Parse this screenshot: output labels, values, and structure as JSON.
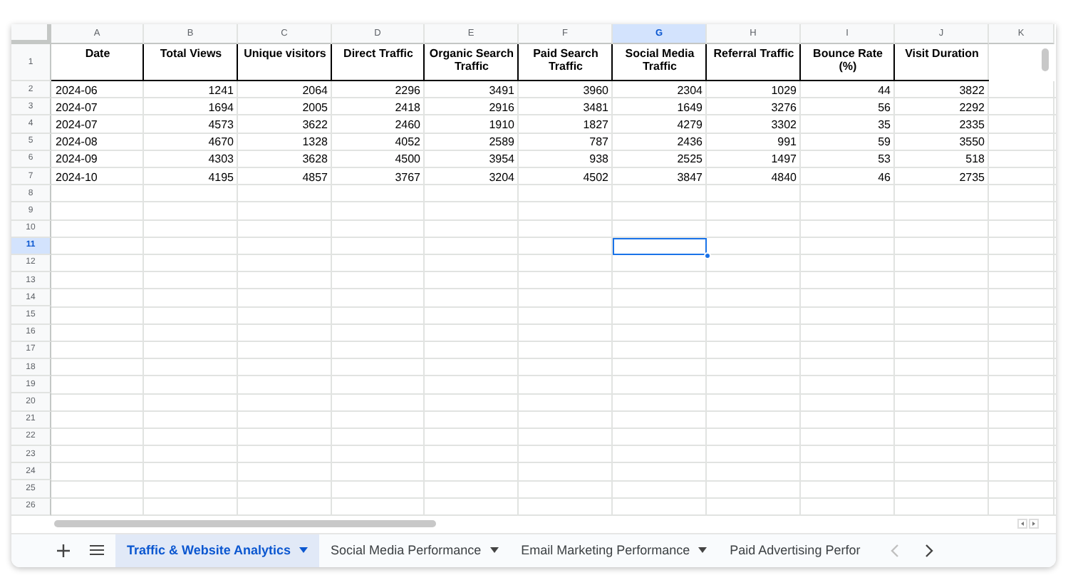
{
  "columns": [
    {
      "label": "A",
      "selected": false,
      "kind": "text"
    },
    {
      "label": "B",
      "selected": false,
      "kind": "number"
    },
    {
      "label": "C",
      "selected": false,
      "kind": "number"
    },
    {
      "label": "D",
      "selected": false,
      "kind": "number"
    },
    {
      "label": "E",
      "selected": false,
      "kind": "number"
    },
    {
      "label": "F",
      "selected": false,
      "kind": "number"
    },
    {
      "label": "G",
      "selected": true,
      "kind": "number"
    },
    {
      "label": "H",
      "selected": false,
      "kind": "number"
    },
    {
      "label": "I",
      "selected": false,
      "kind": "number"
    },
    {
      "label": "J",
      "selected": false,
      "kind": "number"
    },
    {
      "label": "K",
      "selected": false,
      "kind": "number"
    }
  ],
  "rows": [
    {
      "label": "1",
      "selected": false,
      "kind": "header",
      "cells": [
        "Date",
        "Total Views",
        "Unique visitors",
        "Direct Traffic",
        "Organic Search Traffic",
        "Paid Search Traffic",
        "Social Media Traffic",
        "Referral Traffic",
        "Bounce Rate (%)",
        "Visit Duration"
      ]
    },
    {
      "label": "2",
      "selected": false,
      "kind": "data",
      "cells": [
        "2024-06",
        "1241",
        "2064",
        "2296",
        "3491",
        "3960",
        "2304",
        "1029",
        "44",
        "3822"
      ]
    },
    {
      "label": "3",
      "selected": false,
      "kind": "data",
      "cells": [
        "2024-07",
        "1694",
        "2005",
        "2418",
        "2916",
        "3481",
        "1649",
        "3276",
        "56",
        "2292"
      ]
    },
    {
      "label": "4",
      "selected": false,
      "kind": "data",
      "cells": [
        "2024-07",
        "4573",
        "3622",
        "2460",
        "1910",
        "1827",
        "4279",
        "3302",
        "35",
        "2335"
      ]
    },
    {
      "label": "5",
      "selected": false,
      "kind": "data",
      "cells": [
        "2024-08",
        "4670",
        "1328",
        "4052",
        "2589",
        "787",
        "2436",
        "991",
        "59",
        "3550"
      ]
    },
    {
      "label": "6",
      "selected": false,
      "kind": "data",
      "cells": [
        "2024-09",
        "4303",
        "3628",
        "4500",
        "3954",
        "938",
        "2525",
        "1497",
        "53",
        "518"
      ]
    },
    {
      "label": "7",
      "selected": false,
      "kind": "data",
      "cells": [
        "2024-10",
        "4195",
        "4857",
        "3767",
        "3204",
        "4502",
        "3847",
        "4840",
        "46",
        "2735"
      ]
    },
    {
      "label": "8",
      "selected": false,
      "kind": "data"
    },
    {
      "label": "9",
      "selected": false,
      "kind": "data"
    },
    {
      "label": "10",
      "selected": false,
      "kind": "data"
    },
    {
      "label": "11",
      "selected": true,
      "kind": "data"
    },
    {
      "label": "12",
      "selected": false,
      "kind": "data"
    },
    {
      "label": "13",
      "selected": false,
      "kind": "data"
    },
    {
      "label": "14",
      "selected": false,
      "kind": "data"
    },
    {
      "label": "15",
      "selected": false,
      "kind": "data"
    },
    {
      "label": "16",
      "selected": false,
      "kind": "data"
    },
    {
      "label": "17",
      "selected": false,
      "kind": "data"
    },
    {
      "label": "18",
      "selected": false,
      "kind": "data"
    },
    {
      "label": "19",
      "selected": false,
      "kind": "data"
    },
    {
      "label": "20",
      "selected": false,
      "kind": "data"
    },
    {
      "label": "21",
      "selected": false,
      "kind": "data"
    },
    {
      "label": "22",
      "selected": false,
      "kind": "data"
    },
    {
      "label": "23",
      "selected": false,
      "kind": "data"
    },
    {
      "label": "24",
      "selected": false,
      "kind": "data"
    },
    {
      "label": "25",
      "selected": false,
      "kind": "data"
    },
    {
      "label": "26",
      "selected": false,
      "kind": "data"
    }
  ],
  "sheet_tabs": [
    {
      "label": "Traffic & Website Analytics",
      "selected": true,
      "has_menu": true
    },
    {
      "label": "Social Media Performance",
      "selected": false,
      "has_menu": true
    },
    {
      "label": "Email Marketing Performance",
      "selected": false,
      "has_menu": true
    },
    {
      "label": "Paid Advertising Perfor",
      "selected": false,
      "has_menu": false
    }
  ],
  "tab_scroll": {
    "previous_disabled": true,
    "next_disabled": false
  }
}
